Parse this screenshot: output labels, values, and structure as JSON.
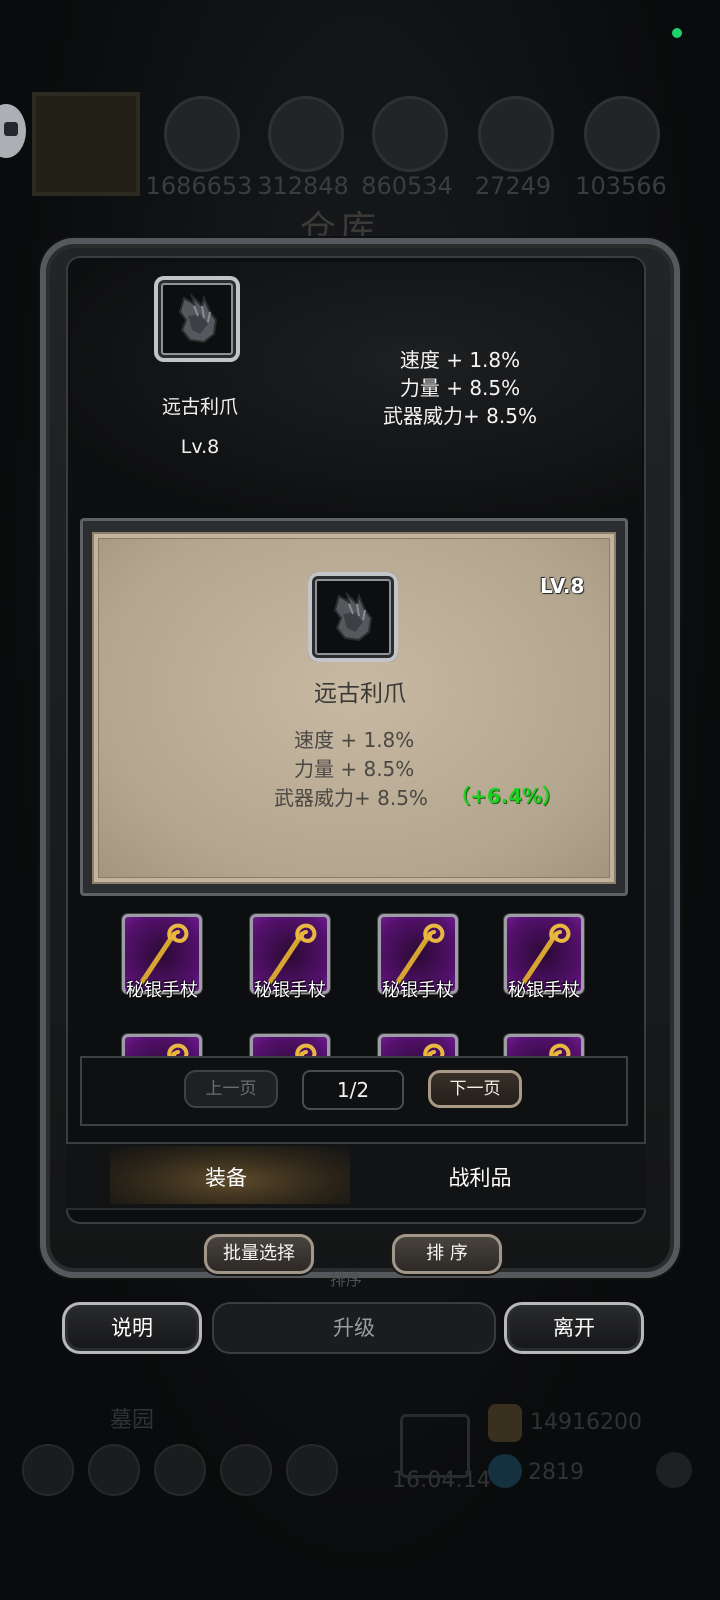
{
  "background": {
    "resources": [
      "1686653",
      "312848",
      "860534",
      "27249",
      "103566"
    ],
    "title": "仓库",
    "location": "墓园",
    "gold": "14916200",
    "gems": "2819",
    "time": "16:04:14"
  },
  "top_item": {
    "name": "远古利爪",
    "level": "Lv.8",
    "stats": [
      "速度 + 1.8%",
      "力量 + 8.5%",
      "武器威力+ 8.5%"
    ]
  },
  "detail_card": {
    "level": "LV.8",
    "name": "远古利爪",
    "stats": [
      "速度 + 1.8%",
      "力量 + 8.5%",
      "武器威力+ 8.5%"
    ],
    "bonus": "（+6.4%）"
  },
  "grid": {
    "items": [
      "秘银手杖",
      "秘银手杖",
      "秘银手杖",
      "秘银手杖"
    ]
  },
  "pagination": {
    "prev_label": "上一页",
    "indicator": "1/2",
    "next_label": "下一页"
  },
  "tabs": {
    "equipment": "装备",
    "loot": "战利品"
  },
  "actions": {
    "batch_select": "批量选择",
    "sort": "排 序",
    "sort_hint": "排序",
    "info": "说明",
    "upgrade": "升级",
    "leave": "离开"
  },
  "colors": {
    "bonus_green": "#1fcf23",
    "status_dot": "#1fd16b",
    "rare_purple": "#55116e"
  }
}
